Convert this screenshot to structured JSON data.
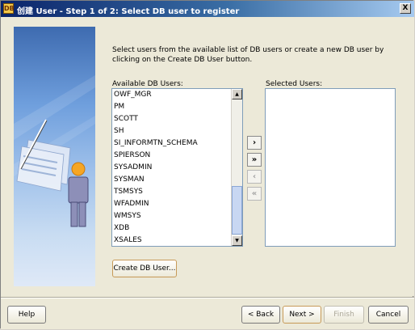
{
  "window": {
    "title": "创建 User - Step 1 of 2: Select DB user to register",
    "icon": "database-app-icon",
    "close_label": "X"
  },
  "intro_text": "Select users from the available list of DB users or create a new DB user by clicking on the Create DB User button.",
  "available": {
    "label": "Available DB Users:",
    "items": [
      "OWF_MGR",
      "PM",
      "SCOTT",
      "SH",
      "SI_INFORMTN_SCHEMA",
      "SPIERSON",
      "SYSADMIN",
      "SYSMAN",
      "TSMSYS",
      "WFADMIN",
      "WMSYS",
      "XDB",
      "XSALES"
    ]
  },
  "selected": {
    "label": "Selected Users:",
    "items": []
  },
  "move_buttons": {
    "move_one": "›",
    "move_all": "»",
    "remove_one": "‹",
    "remove_all": "«"
  },
  "create_button": "Create DB User...",
  "footer": {
    "help": "Help",
    "back": "< Back",
    "next": "Next >",
    "finish": "Finish",
    "cancel": "Cancel"
  },
  "colors": {
    "titlebar_start": "#0a246a",
    "titlebar_end": "#a6caf0",
    "side_panel": "#6f9fdd"
  }
}
